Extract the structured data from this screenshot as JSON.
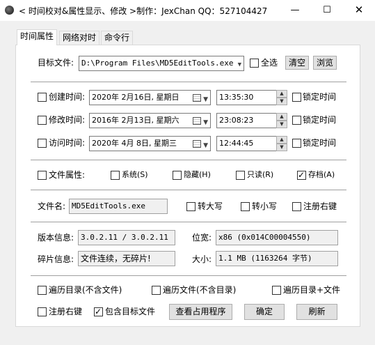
{
  "window": {
    "title": "< 时间校对&属性显示、修改 >制作：JexChan  QQ：527104427",
    "min_glyph": "—",
    "max_glyph": "☐",
    "close_glyph": "✕"
  },
  "tabs": [
    {
      "label": "时间属性",
      "active": true
    },
    {
      "label": "网络对时",
      "active": false
    },
    {
      "label": "命令行",
      "active": false
    }
  ],
  "target": {
    "label": "目标文件:",
    "path": "D:\\Program Files\\MD5EditTools.exe",
    "select_all_label": "全选",
    "clear_label": "清空",
    "browse_label": "浏览"
  },
  "time_rows": [
    {
      "label": "创建时间:",
      "date": "2020年 2月16日, 星期日",
      "time": "13:35:30",
      "lock_label": "锁定时间"
    },
    {
      "label": "修改时间:",
      "date": "2016年 2月13日, 星期六",
      "time": "23:08:23",
      "lock_label": "锁定时间"
    },
    {
      "label": "访问时间:",
      "date": "2020年 4月 8日, 星期三",
      "time": "12:44:45",
      "lock_label": "锁定时间"
    }
  ],
  "attributes": {
    "label": "文件属性:",
    "items": [
      {
        "label": "系统(S)",
        "checked": false
      },
      {
        "label": "隐藏(H)",
        "checked": false
      },
      {
        "label": "只读(R)",
        "checked": false
      },
      {
        "label": "存档(A)",
        "checked": true
      }
    ]
  },
  "filename": {
    "label": "文件名:",
    "value": "MD5EditTools.exe",
    "upper_label": "转大写",
    "lower_label": "转小写",
    "register_label": "注册右键"
  },
  "info": {
    "version_label": "版本信息:",
    "version_value": "3.0.2.11 / 3.0.2.11",
    "bitness_label": "位宽:",
    "bitness_value": "x86 (0x014C00004550)",
    "frag_label": "碎片信息:",
    "frag_value": "文件连续，无碎片!",
    "size_label": "大小:",
    "size_value": "1.1 MB (1163264 字节)"
  },
  "options": {
    "traverse_dirs": "遍历目录(不含文件)",
    "traverse_files": "遍历文件(不含目录)",
    "traverse_both": "遍历目录+文件",
    "register_context": "注册右键",
    "include_target": "包含目标文件",
    "include_target_checked": true
  },
  "buttons": {
    "view_usage": "查看占用程序",
    "ok": "确定",
    "refresh": "刷新"
  }
}
